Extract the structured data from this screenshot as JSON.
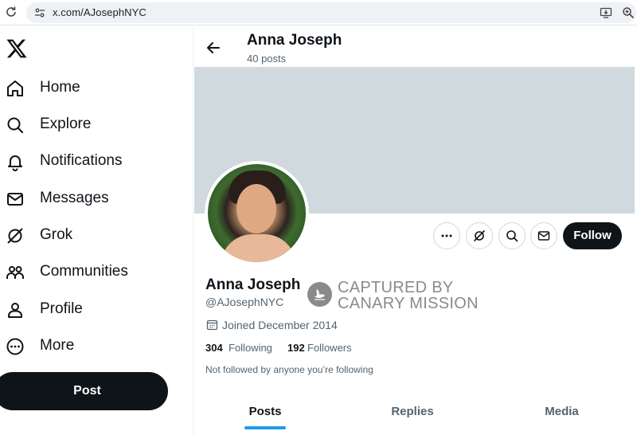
{
  "browser": {
    "url": "x.com/AJosephNYC"
  },
  "sidebar": {
    "items": [
      {
        "label": "Home",
        "icon": "home-icon"
      },
      {
        "label": "Explore",
        "icon": "search-icon"
      },
      {
        "label": "Notifications",
        "icon": "bell-icon"
      },
      {
        "label": "Messages",
        "icon": "envelope-icon"
      },
      {
        "label": "Grok",
        "icon": "grok-icon"
      },
      {
        "label": "Communities",
        "icon": "people-icon"
      },
      {
        "label": "Profile",
        "icon": "person-icon"
      },
      {
        "label": "More",
        "icon": "more-circle-icon"
      }
    ],
    "post_label": "Post"
  },
  "header": {
    "name": "Anna Joseph",
    "posts_count": "40 posts"
  },
  "profile": {
    "name": "Anna Joseph",
    "handle": "@AJosephNYC",
    "joined": "Joined December 2014",
    "following_count": "304",
    "following_label": "Following",
    "followers_count": "192",
    "followers_label": "Followers",
    "not_followed": "Not followed by anyone you’re following",
    "follow_label": "Follow"
  },
  "watermark": {
    "line1": "CAPTURED BY",
    "line2": "CANARY MISSION"
  },
  "tabs": [
    {
      "label": "Posts",
      "active": true
    },
    {
      "label": "Replies",
      "active": false
    },
    {
      "label": "Media",
      "active": false
    }
  ],
  "colors": {
    "accent": "#1d9bf0",
    "banner": "#cfd9de",
    "text_primary": "#0f1419",
    "text_secondary": "#536471"
  }
}
